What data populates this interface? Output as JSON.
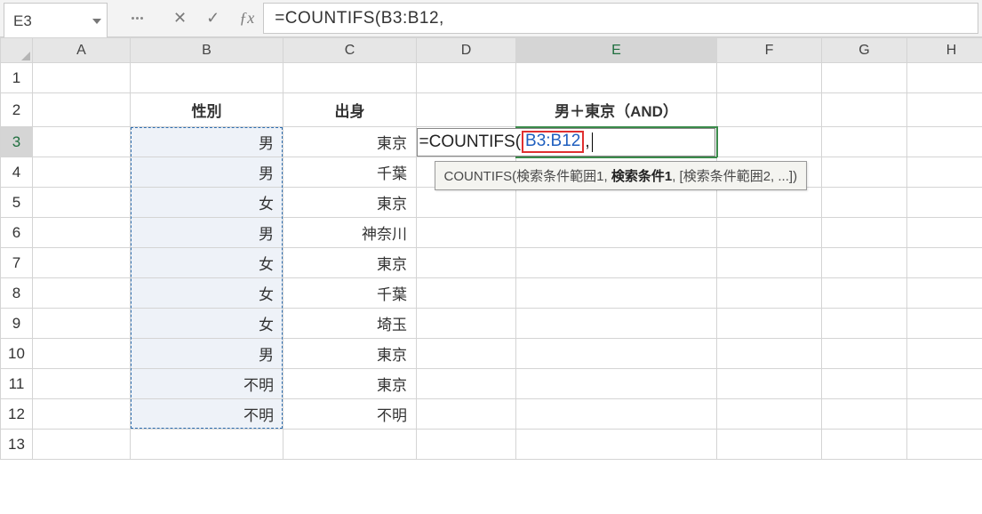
{
  "name_box": "E3",
  "formula_bar": "=COUNTIFS(B3:B12,",
  "columns": [
    "A",
    "B",
    "C",
    "D",
    "E",
    "F",
    "G",
    "H"
  ],
  "rows": [
    "1",
    "2",
    "3",
    "4",
    "5",
    "6",
    "7",
    "8",
    "9",
    "10",
    "11",
    "12",
    "13"
  ],
  "headers": {
    "B2": "性別",
    "C2": "出身",
    "E2": "男＋東京（AND）"
  },
  "data_rows": [
    {
      "b": "男",
      "c": "東京"
    },
    {
      "b": "男",
      "c": "千葉"
    },
    {
      "b": "女",
      "c": "東京"
    },
    {
      "b": "男",
      "c": "神奈川"
    },
    {
      "b": "女",
      "c": "東京"
    },
    {
      "b": "女",
      "c": "千葉"
    },
    {
      "b": "女",
      "c": "埼玉"
    },
    {
      "b": "男",
      "c": "東京"
    },
    {
      "b": "不明",
      "c": "東京"
    },
    {
      "b": "不明",
      "c": "不明"
    }
  ],
  "edit_cell": {
    "prefix": "=COUNTIFS(",
    "range": "B3:B12",
    "suffix": ","
  },
  "tooltip": {
    "fn": "COUNTIFS",
    "arg1": "検索条件範囲1",
    "cur": "検索条件1",
    "rest": "[検索条件範囲2, ...]"
  },
  "active_col": "E",
  "active_row": "3"
}
